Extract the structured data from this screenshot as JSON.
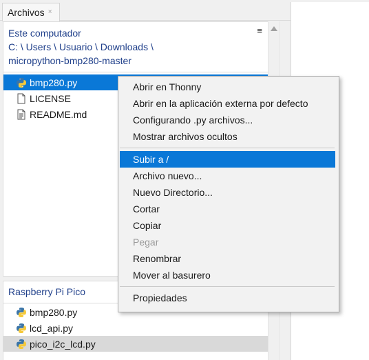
{
  "tab": {
    "label": "Archivos",
    "close": "×"
  },
  "local": {
    "title": "Este computador",
    "path_line1": "C: \\ Users \\ Usuario \\ Downloads \\",
    "path_line2": "micropython-bmp280-master",
    "menu_glyph": "≡",
    "files": [
      {
        "name": "bmp280.py",
        "icon": "python-icon",
        "selected": true
      },
      {
        "name": "LICENSE",
        "icon": "file-icon",
        "selected": false
      },
      {
        "name": "README.md",
        "icon": "text-file-icon",
        "selected": false
      }
    ]
  },
  "device": {
    "title": "Raspberry Pi Pico",
    "files": [
      {
        "name": "bmp280.py",
        "icon": "python-icon"
      },
      {
        "name": "lcd_api.py",
        "icon": "python-icon"
      },
      {
        "name": "pico_i2c_lcd.py",
        "icon": "python-icon",
        "highlight": true
      }
    ]
  },
  "context_menu": {
    "group1": [
      "Abrir en Thonny",
      "Abrir en la aplicación externa por defecto",
      "Configurando .py archivos...",
      "Mostrar archivos ocultos"
    ],
    "group2": [
      "Subir a /",
      "Archivo nuevo...",
      "Nuevo Directorio...",
      "Cortar",
      "Copiar",
      "Pegar",
      "Renombrar",
      "Mover al basurero"
    ],
    "group3": [
      "Propiedades"
    ],
    "active_item": "Subir a /",
    "disabled_item": "Pegar"
  },
  "colors": {
    "accent": "#0a78d7",
    "header_text": "#1f3f8a",
    "selection_gray": "#d9d9d9"
  }
}
